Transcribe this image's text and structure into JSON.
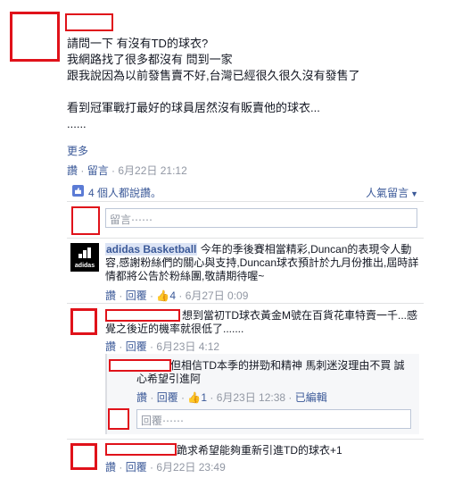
{
  "post": {
    "lines": [
      "請問一下 有沒有TD的球衣?",
      "我網路找了很多都沒有 問到一家",
      "跟我說因為以前發售賣不好,台灣已經很久很久沒有發售了",
      "",
      "看到冠軍戰打最好的球員居然沒有販賣他的球衣...",
      "......"
    ],
    "more": "更多",
    "meta": {
      "like": "讚",
      "sep": " · ",
      "comment": "留言",
      "time": "6月22日 21:12"
    }
  },
  "ufi": {
    "likes": "4 個人都說讚。",
    "sort": "人氣留言",
    "sort_caret": "▼",
    "comment_placeholder": "留言⋯⋯"
  },
  "comments": [
    {
      "name": "adidas Basketball",
      "text": "今年的季後賽相當精彩,Duncan的表現令人動容,感謝粉絲們的關心與支持,Duncan球衣預計於九月份推出,屆時詳情都將公告於粉絲團,敬請期待喔~",
      "meta": {
        "like": "讚",
        "reply": "回覆",
        "likes_count": "4",
        "time": "6月27日 0:09"
      },
      "logo_text": "adidas"
    },
    {
      "text": "想到當初TD球衣黃金M號在百貨花車特賣一千...感覺之後近的機率就很低了.......",
      "meta": {
        "like": "讚",
        "reply": "回覆",
        "time": "6月23日 4:12"
      },
      "replies": [
        {
          "text": "但相信TD本季的拼勁和精神 馬刺迷沒理由不買 誠心希望引進阿",
          "meta": {
            "like": "讚",
            "reply": "回覆",
            "likes_count": "1",
            "time": "6月23日 12:38",
            "edited": "已編輯"
          }
        }
      ],
      "reply_placeholder": "回覆⋯⋯"
    },
    {
      "text": "跪求希望能夠重新引進TD的球衣+1",
      "meta": {
        "like": "讚",
        "reply": "回覆",
        "time": "6月22日 23:49"
      }
    }
  ],
  "colors": {
    "link": "#3b5998",
    "meta": "#9197a3",
    "redaction": "#e0121a",
    "ufi_bg": "#f6f7f9"
  }
}
